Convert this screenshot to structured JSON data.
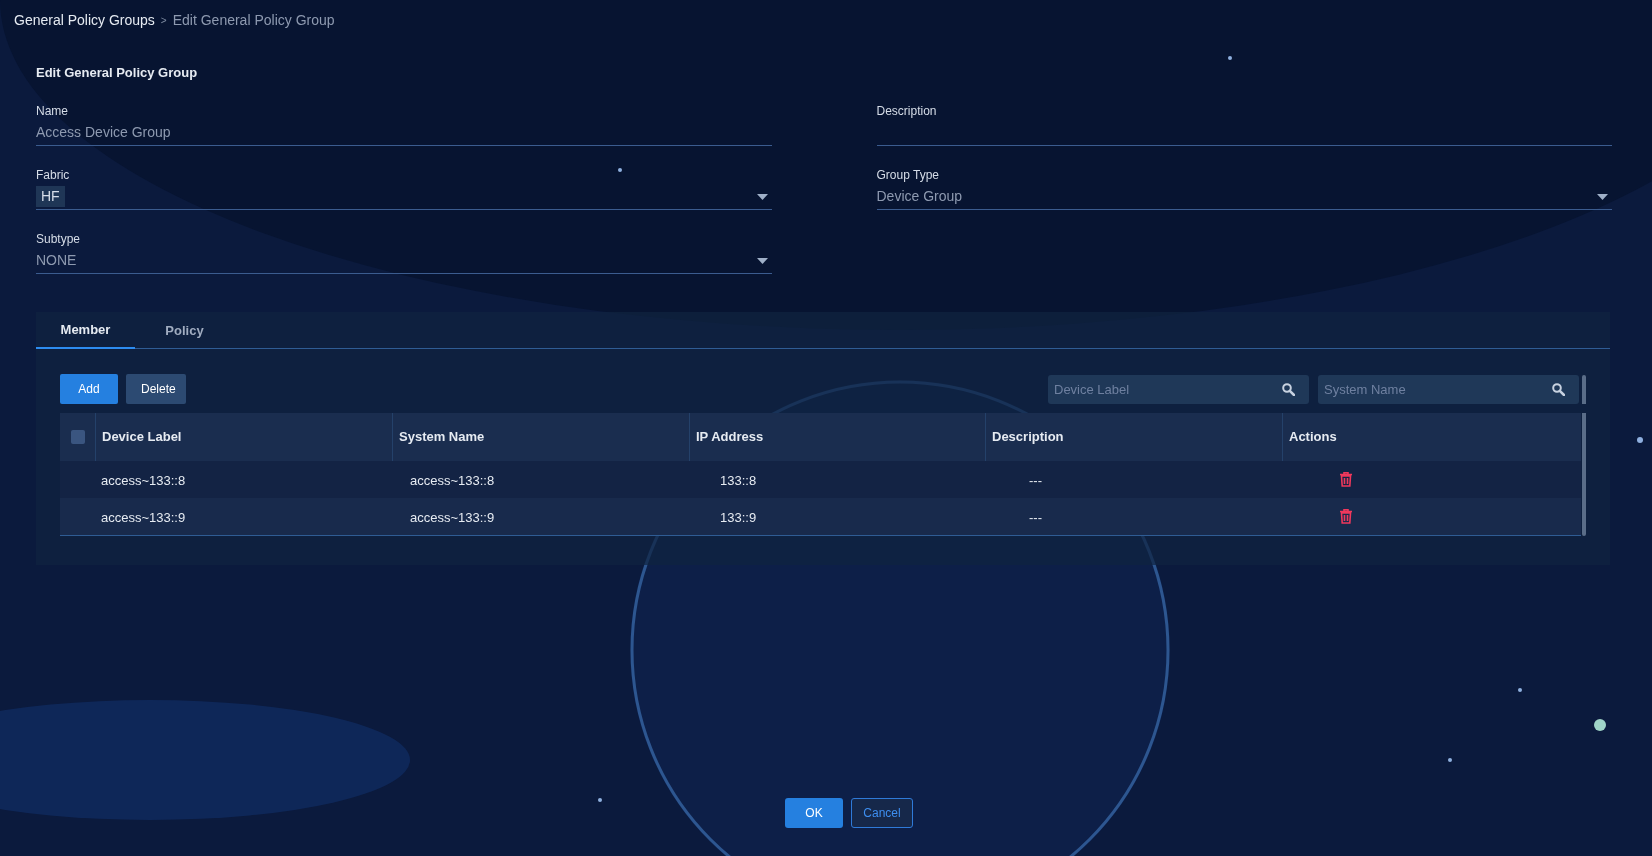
{
  "breadcrumb": [
    {
      "label": "General Policy Groups",
      "current": false
    },
    {
      "label": "Edit General Policy Group",
      "current": true
    }
  ],
  "breadcrumb_separator": ">",
  "title": "Edit General Policy Group",
  "fields": [
    {
      "label": "Name",
      "kind": "input",
      "value": "Access Device Group"
    },
    {
      "label": "Description",
      "kind": "input"
    },
    {
      "label": "Fabric",
      "kind": "select",
      "chips": [
        "HF"
      ]
    },
    {
      "label": "Group Type",
      "kind": "select",
      "value": "Device Group"
    },
    {
      "label": "Subtype",
      "kind": "select",
      "value": "NONE"
    }
  ],
  "tabs": [
    {
      "label": "Member",
      "selected": true
    },
    {
      "label": "Policy",
      "selected": false
    }
  ],
  "toolbar_buttons": [
    {
      "label": "Add",
      "kind": "primary"
    },
    {
      "label": "Delete",
      "kind": "secondary"
    }
  ],
  "search_fields": [
    {
      "placeholder": "Device Label"
    },
    {
      "placeholder": "System Name"
    }
  ],
  "table": {
    "select_all_checked": false,
    "columns": [
      "Device Label",
      "System Name",
      "IP Address",
      "Description",
      "Actions"
    ],
    "rows": [
      {
        "cells": [
          "access~133::8",
          "access~133::8",
          "133::8",
          "---"
        ]
      },
      {
        "cells": [
          "access~133::9",
          "access~133::9",
          "133::9",
          "---"
        ]
      }
    ]
  },
  "footer_buttons": [
    {
      "label": "OK",
      "kind": "primary"
    },
    {
      "label": "Cancel",
      "kind": "secondary"
    }
  ]
}
